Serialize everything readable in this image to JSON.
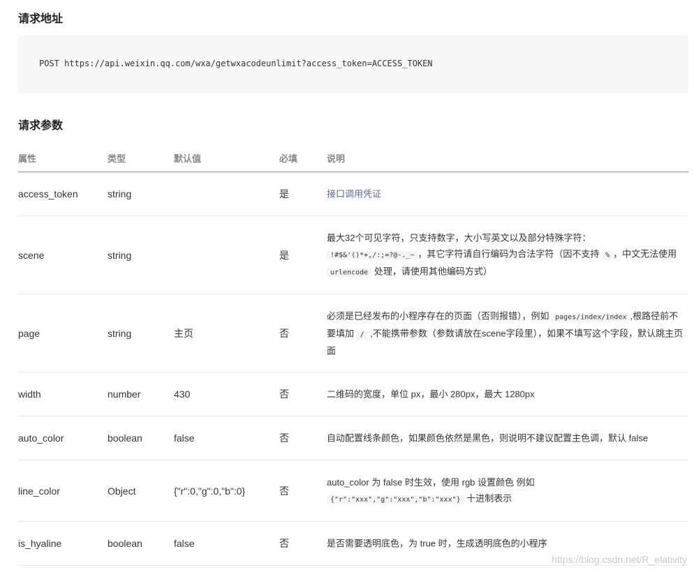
{
  "section_url": {
    "title": "请求地址"
  },
  "request": {
    "code": "POST https://api.weixin.qq.com/wxa/getwxacodeunlimit?access_token=ACCESS_TOKEN"
  },
  "section_params": {
    "title": "请求参数"
  },
  "table": {
    "headers": {
      "attr": "属性",
      "type": "类型",
      "default": "默认值",
      "required": "必填",
      "desc": "说明"
    },
    "rows": [
      {
        "attr": "access_token",
        "type": "string",
        "default": "",
        "required": "是",
        "desc": "接口调用凭证"
      },
      {
        "attr": "scene",
        "type": "string",
        "default": "",
        "required": "是",
        "desc_parts": [
          "最大32个可见字符，只支持数字，大小写英文以及部分特殊字符：",
          "!#$&'()*+,/:;=?@-._~",
          "，其它字符请自行编码为合法字符（因不支持",
          "%",
          "，中文无法使用",
          "urlencode",
          "处理，请使用其他编码方式）"
        ]
      },
      {
        "attr": "page",
        "type": "string",
        "default": "主页",
        "required": "否",
        "desc_parts": [
          "必须是已经发布的小程序存在的页面（否则报错），例如",
          "pages/index/index",
          ",根路径前不要填加",
          "/",
          ",不能携带参数（参数请放在scene字段里），如果不填写这个字段，默认跳主页面"
        ]
      },
      {
        "attr": "width",
        "type": "number",
        "default": "430",
        "required": "否",
        "desc": "二维码的宽度，单位 px，最小 280px，最大 1280px"
      },
      {
        "attr": "auto_color",
        "type": "boolean",
        "default": "false",
        "required": "否",
        "desc": "自动配置线条颜色，如果颜色依然是黑色，则说明不建议配置主色调，默认 false"
      },
      {
        "attr": "line_color",
        "type": "Object",
        "default": "{\"r\":0,\"g\":0,\"b\":0}",
        "required": "否",
        "desc_parts": [
          "auto_color 为 false 时生效，使用 rgb 设置颜色 例如",
          "{\"r\":\"xxx\",\"g\":\"xxx\",\"b\":\"xxx\"}",
          "十进制表示"
        ]
      },
      {
        "attr": "is_hyaline",
        "type": "boolean",
        "default": "false",
        "required": "否",
        "desc": "是否需要透明底色，为 true 时，生成透明底色的小程序"
      }
    ]
  },
  "watermark": "https://blog.csdn.net/R_elativity",
  "colors": {
    "link": "#576b95",
    "code_bg": "#f7f7f7",
    "header_text": "#888888"
  }
}
